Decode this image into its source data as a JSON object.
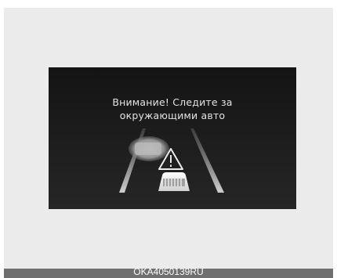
{
  "display": {
    "warning_line1": "Внимание! Следите за",
    "warning_line2": "окружающими авто",
    "warning_icon": "warning-triangle-icon",
    "background_color": "#1a1a1a",
    "text_color": "#e4e4e4"
  },
  "caption": {
    "code": "OKA4050139RU",
    "background_color": "#6f6f6f"
  }
}
